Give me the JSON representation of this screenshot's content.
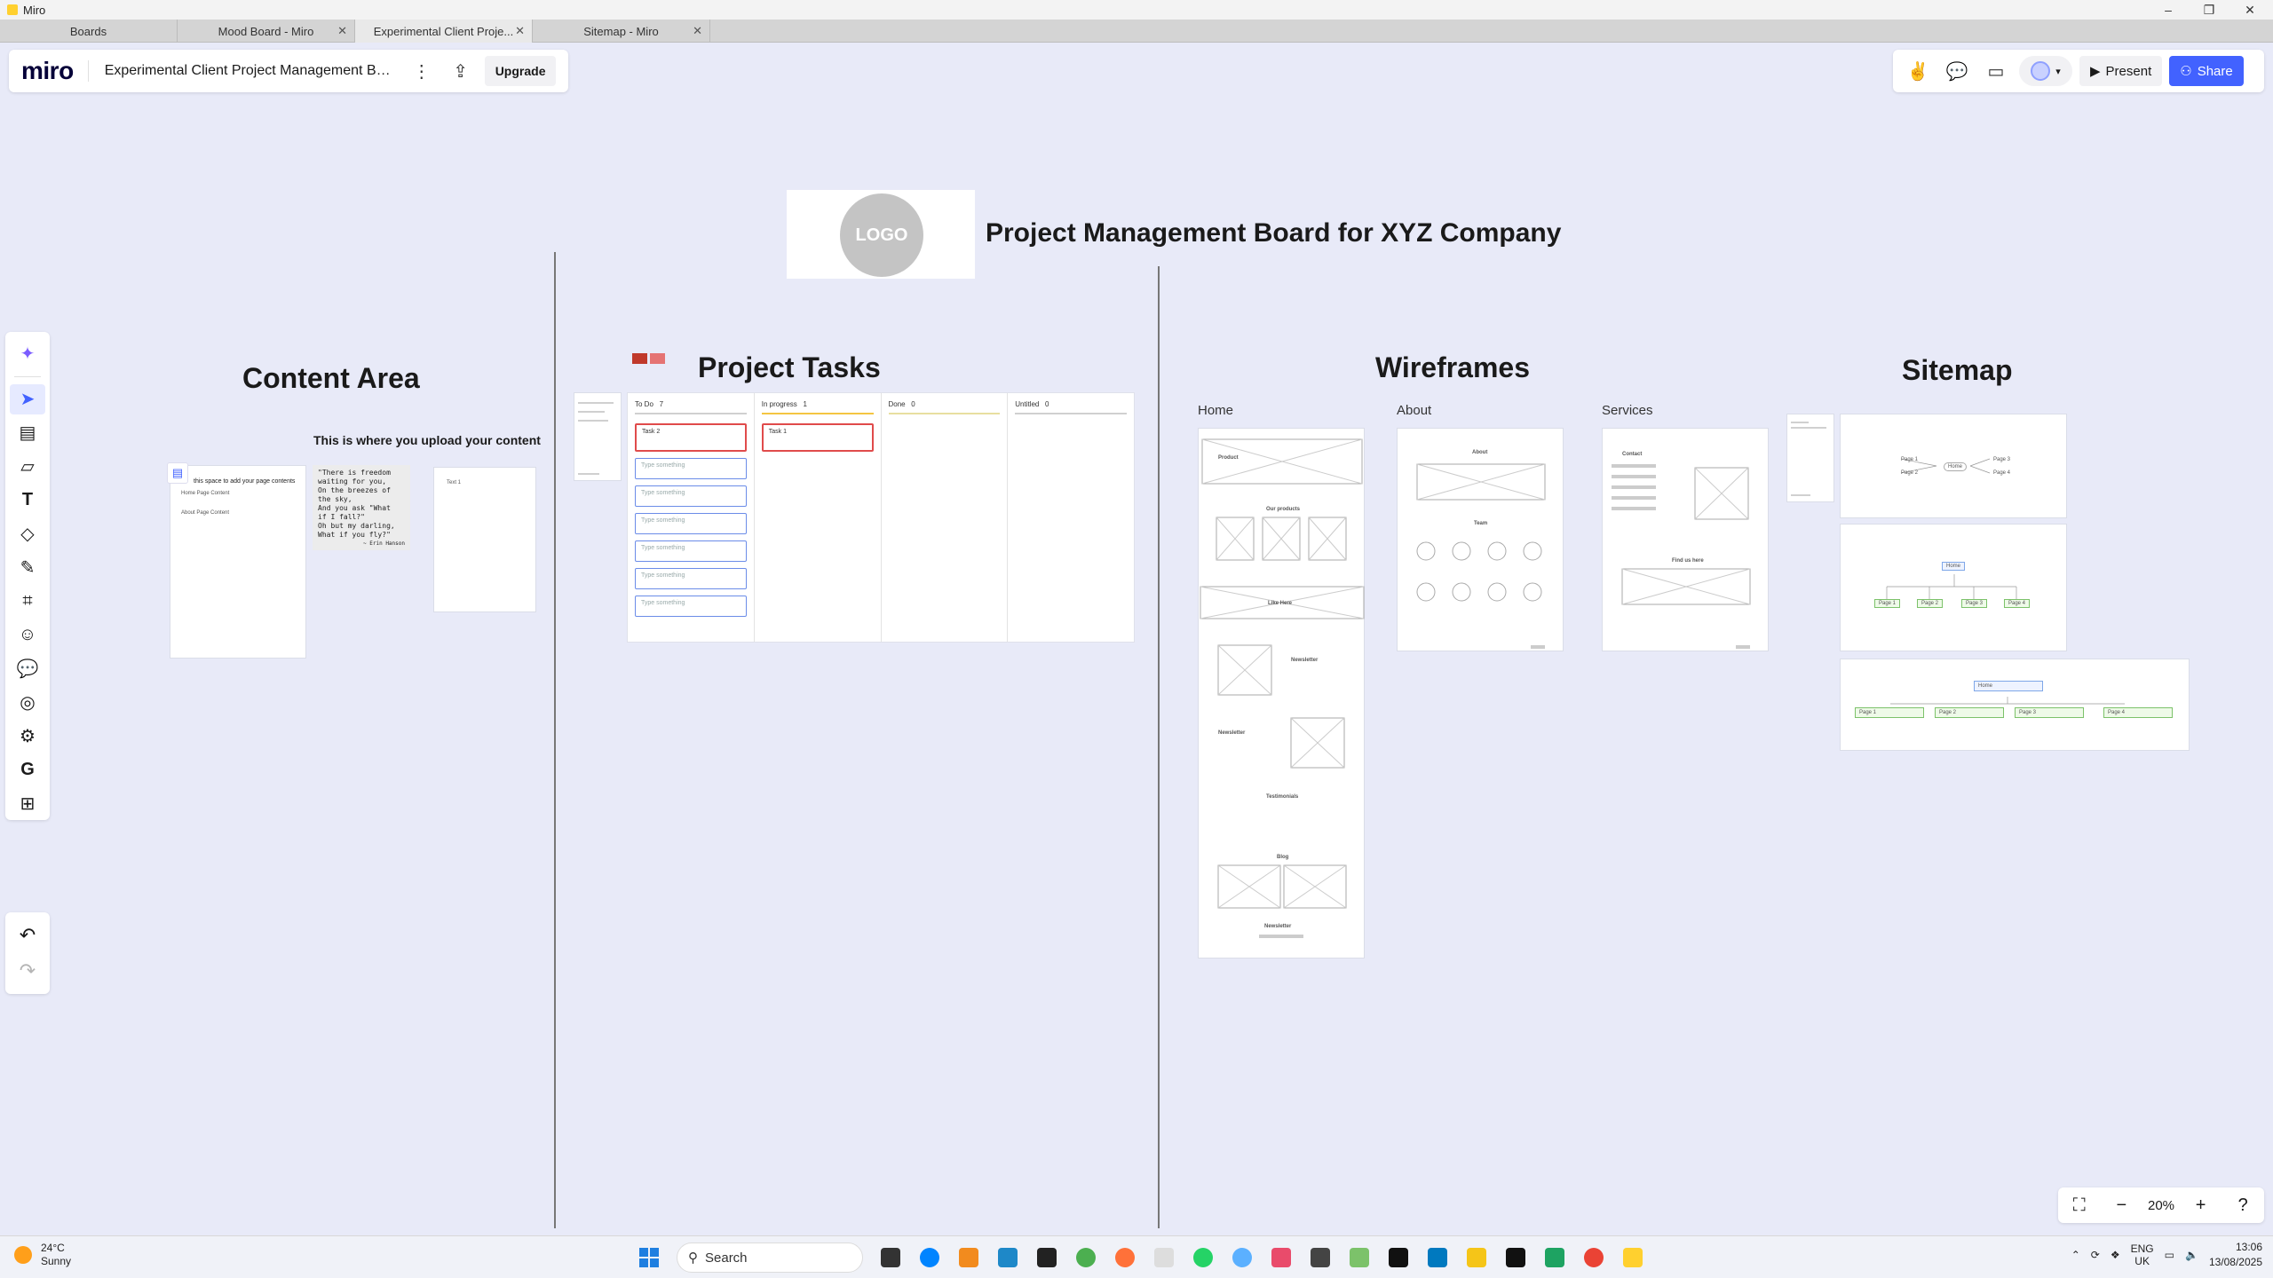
{
  "window": {
    "title": "Miro",
    "controls": {
      "minimize": "–",
      "maximize": "❐",
      "close": "✕"
    }
  },
  "tabs": [
    {
      "label": "Boards",
      "closable": false,
      "active": false
    },
    {
      "label": "Mood Board - Miro",
      "closable": true,
      "active": false
    },
    {
      "label": "Experimental Client Proje...",
      "closable": true,
      "active": true
    },
    {
      "label": "Sitemap - Miro",
      "closable": true,
      "active": false
    }
  ],
  "boardbar": {
    "logo": "miro",
    "board_name": "Experimental Client Project Management Boa...",
    "upgrade_label": "Upgrade",
    "icons": [
      "more-icon",
      "export-icon"
    ]
  },
  "topright": {
    "present_label": "Present",
    "share_label": "Share",
    "icons": [
      "reactions-icon",
      "comments-icon",
      "video-icon",
      "avatar",
      "chevron-down-icon"
    ]
  },
  "lefttools": [
    "ai-sparkle-icon",
    "select-cursor-icon",
    "templates-icon",
    "sticky-note-icon",
    "text-icon",
    "shapes-icon",
    "pen-icon",
    "frame-icon",
    "sticker-icon",
    "comment-icon",
    "more-apps-icon",
    "integrations-icon",
    "google-icon",
    "add-app-icon"
  ],
  "zoom": {
    "level": "20%"
  },
  "board": {
    "logo_text": "LOGO",
    "main_title": "Project Management Board for XYZ Company",
    "sections": {
      "content_area": "Content Area",
      "project_tasks": "Project Tasks",
      "wireframes": "Wireframes",
      "sitemap": "Sitemap"
    },
    "content": {
      "upload_note": "This is where you upload your content",
      "doc_title": "this space to add your page contents",
      "doc_line1": "Home Page Content",
      "doc_line2": "About Page Content",
      "quote_lines": [
        "\"There is freedom",
        "waiting for you,",
        "On the breezes of",
        "the sky,",
        "And you ask \"What",
        "if I fall?\"",
        "Oh but my darling,",
        "What if you fly?\""
      ],
      "quote_author": "~ Erin Hanson",
      "text_card": "Text 1"
    },
    "kanban": {
      "columns": [
        {
          "name": "To Do",
          "count": "7",
          "color": "#d0d0d0",
          "cards": [
            "Task 2",
            "Type something",
            "Type something",
            "Type something",
            "Type something",
            "Type something",
            "Type something"
          ]
        },
        {
          "name": "In progress",
          "count": "1",
          "color": "#f4c542",
          "cards": [
            "Task 1"
          ]
        },
        {
          "name": "Done",
          "count": "0",
          "color": "#e8dfa0",
          "cards": []
        },
        {
          "name": "Untitled",
          "count": "0",
          "color": "#d0d0d0",
          "cards": []
        }
      ]
    },
    "wireframes": {
      "labels": {
        "home": "Home",
        "about": "About",
        "services": "Services"
      },
      "home_texts": [
        "Product",
        "Our products",
        "Like Here",
        "Newsletter",
        "Newsletter",
        "Testimonials",
        "Blog",
        "Newsletter"
      ],
      "about_texts": [
        "About",
        "Team"
      ],
      "services_texts": [
        "Contact",
        "Find us here"
      ]
    },
    "sitemap": {
      "center_node": "Home",
      "nodes": [
        "Page 1",
        "Page 2",
        "Page 3",
        "Page 4"
      ]
    }
  },
  "taskbar": {
    "weather_temp": "24°C",
    "weather_desc": "Sunny",
    "search_placeholder": "Search",
    "language": "ENG",
    "region": "UK",
    "time": "13:06",
    "date": "13/08/2025"
  }
}
